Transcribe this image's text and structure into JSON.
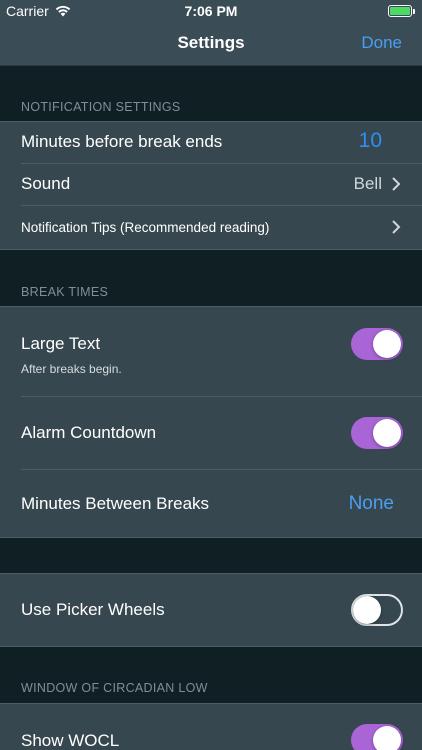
{
  "status_bar": {
    "carrier": "Carrier",
    "time": "7:06 PM"
  },
  "nav": {
    "title": "Settings",
    "done_label": "Done"
  },
  "notification_settings": {
    "header": "NOTIFICATION SETTINGS",
    "minutes_before_label": "Minutes before break ends",
    "minutes_before_value": "10",
    "sound_label": "Sound",
    "sound_value": "Bell",
    "tips_label": "Notification Tips (Recommended reading)"
  },
  "break_times": {
    "header": "BREAK TIMES",
    "large_text_label": "Large Text",
    "large_text_sub": "After breaks begin.",
    "large_text_on": true,
    "alarm_countdown_label": "Alarm Countdown",
    "alarm_countdown_on": true,
    "minutes_between_label": "Minutes Between Breaks",
    "minutes_between_value": "None"
  },
  "picker": {
    "use_picker_label": "Use Picker Wheels",
    "use_picker_on": false
  },
  "wocl": {
    "header": "WINDOW OF CIRCADIAN LOW",
    "show_wocl_label": "Show WOCL",
    "show_wocl_on": true
  },
  "colors": {
    "accent_blue": "#4a9ff0",
    "toggle_on": "#a964d6",
    "cell_bg": "#37474f",
    "page_bg": "#0f1f24"
  },
  "icons": {
    "wifi": "wifi-icon",
    "battery": "battery-icon",
    "chevron": "chevron-right-icon"
  }
}
